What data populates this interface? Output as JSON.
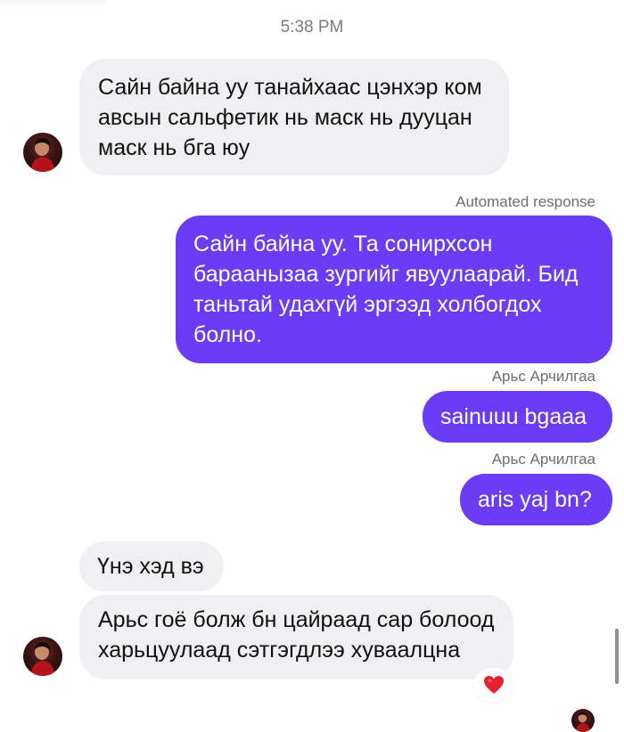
{
  "conversation": {
    "timestamp": "5:38 PM",
    "messages": [
      {
        "direction": "incoming",
        "text": "Сайн байна уу танайхаас цэнхэр ком авсын сальфетик нь маск нь дууцан маск нь бга юу"
      },
      {
        "direction": "outgoing",
        "label": "Automated response",
        "text": "Сайн байна уу. Та сонирхсон бараанызаа зургийг явуулаарай. Бид таньтай удахгүй эргээд холбогдох болно."
      },
      {
        "direction": "outgoing",
        "label": "Арьс Арчилгаа",
        "text": "sainuuu bgaaa"
      },
      {
        "direction": "outgoing",
        "label": "Арьс Арчилгаа",
        "text": "aris yaj bn?"
      },
      {
        "direction": "incoming",
        "text": "Үнэ хэд вэ"
      },
      {
        "direction": "incoming",
        "text": "Арьс гоё болж бн цайраад сар болоод харьцуулаад сэтгэгдлээ хуваалцна",
        "reaction": "❤️"
      }
    ]
  },
  "icons": {
    "reaction": "red-heart-icon",
    "avatar": "contact-avatar"
  },
  "colors": {
    "outgoing_bubble": "#6a3cf5",
    "incoming_bubble": "#f0f0f2",
    "reaction_heart": "#e8202e"
  }
}
